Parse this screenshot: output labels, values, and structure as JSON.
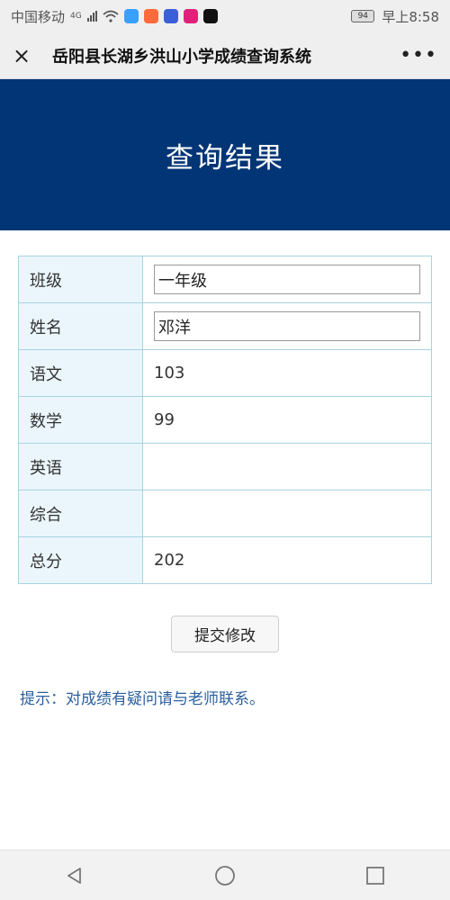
{
  "status_bar": {
    "carrier": "中国移动",
    "network": "4G",
    "battery": "94",
    "time": "早上8:58"
  },
  "nav": {
    "title": "岳阳县长湖乡洪山小学成绩查询系统",
    "close_icon": "×",
    "more_icon": "•••"
  },
  "banner": {
    "title": "查询结果"
  },
  "table": {
    "rows": [
      {
        "label": "班级",
        "value": "一年级"
      },
      {
        "label": "姓名",
        "value": "邓洋"
      },
      {
        "label": "语文",
        "value": "103"
      },
      {
        "label": "数学",
        "value": "99"
      },
      {
        "label": "英语",
        "value": ""
      },
      {
        "label": "综合",
        "value": ""
      },
      {
        "label": "总分",
        "value": "202"
      }
    ]
  },
  "submit_label": "提交修改",
  "hint": "提示：对成绩有疑问请与老师联系。",
  "colors": {
    "banner_bg": "#013576",
    "table_border": "#a8d3e2",
    "label_bg": "#eaf6fb",
    "hint_text": "#2a5f9e"
  }
}
